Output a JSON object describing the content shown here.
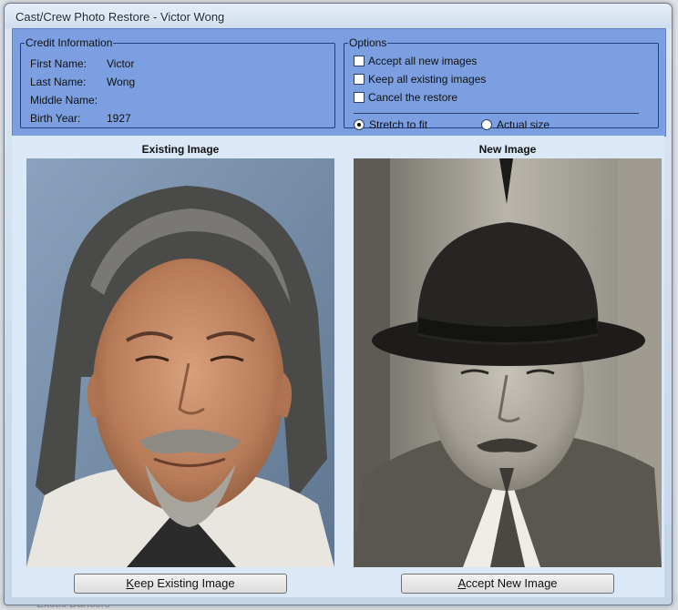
{
  "window": {
    "title": "Cast/Crew Photo Restore - Victor Wong"
  },
  "background": {
    "bottom_text": "Exotic Dancers"
  },
  "credit_info": {
    "legend": "Credit Information",
    "fields": [
      {
        "label": "First Name:",
        "value": "Victor"
      },
      {
        "label": "Last Name:",
        "value": "Wong"
      },
      {
        "label": "Middle Name:",
        "value": ""
      },
      {
        "label": "Birth Year:",
        "value": "1927"
      }
    ]
  },
  "options": {
    "legend": "Options",
    "checkboxes": [
      {
        "label": "Accept all new images",
        "checked": false
      },
      {
        "label": "Keep all existing images",
        "checked": false
      },
      {
        "label": "Cancel the restore",
        "checked": false
      }
    ],
    "radios": [
      {
        "label": "Stretch to fit",
        "checked": true
      },
      {
        "label": "Actual size",
        "checked": false
      }
    ]
  },
  "existing_image": {
    "heading": "Existing Image",
    "button_accel": "K",
    "button_rest": "eep Existing Image"
  },
  "new_image": {
    "heading": "New Image",
    "button_accel": "A",
    "button_rest": "ccept New Image"
  },
  "colors": {
    "panel_blue": "#7b9fe1",
    "image_area": "#dbe8f7",
    "group_border": "#203e86"
  }
}
